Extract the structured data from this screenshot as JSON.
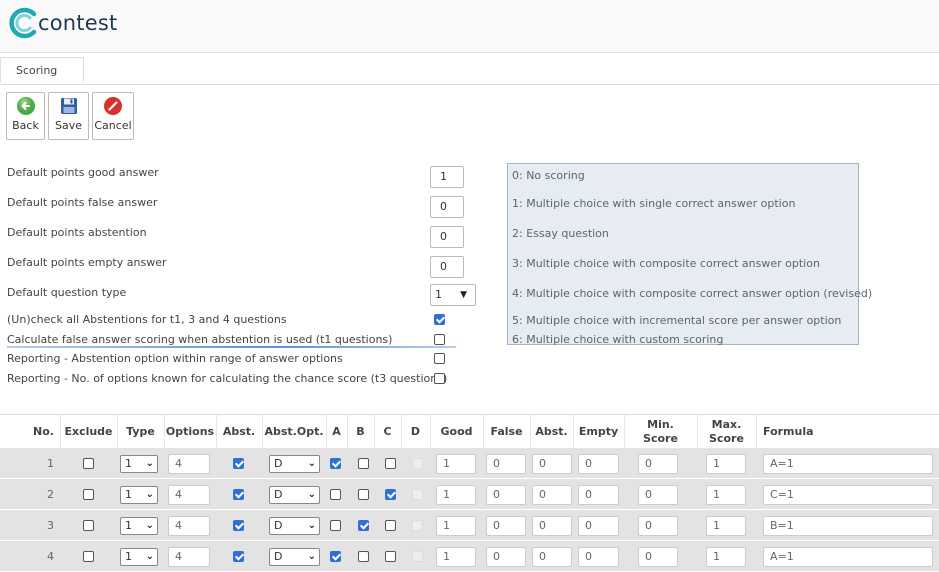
{
  "app": {
    "logo_text": "contest"
  },
  "tabs": [
    {
      "label": "Scoring"
    }
  ],
  "toolbar": {
    "back_label": "Back",
    "save_label": "Save",
    "cancel_label": "Cancel"
  },
  "settings": {
    "good_label": "Default points good answer",
    "good_value": "1",
    "false_label": "Default points false answer",
    "false_value": "0",
    "abst_label": "Default points abstention",
    "abst_value": "0",
    "empty_label": "Default points empty answer",
    "empty_value": "0",
    "qtype_label": "Default question type",
    "qtype_value": "1",
    "uncheck_label": "(Un)check all Abstentions for t1, 3 and 4 questions",
    "calc_label": "Calculate false answer scoring when abstention is used (t1 questions)",
    "report1_label": "Reporting - Abstention option within range of answer options",
    "report2_label": "Reporting - No. of options known for calculating the chance score (t3 questions)"
  },
  "question_types": [
    "0: No scoring",
    "1: Multiple choice with single correct answer option",
    "2: Essay question",
    "3: Multiple choice with composite correct answer option",
    "4: Multiple choice with composite correct answer option (revised)",
    "5: Multiple choice with incremental score per answer option",
    "6: Multiple choice with custom scoring"
  ],
  "grid": {
    "headers": {
      "no": "No.",
      "exclude": "Exclude",
      "type": "Type",
      "options": "Options",
      "abst": "Abst.",
      "abstopt": "Abst.Opt.",
      "a": "A",
      "b": "B",
      "c": "C",
      "d": "D",
      "good": "Good",
      "false": "False",
      "abst2": "Abst.",
      "empty": "Empty",
      "min1": "Min.",
      "min2": "Score",
      "max1": "Max.",
      "max2": "Score",
      "formula": "Formula"
    },
    "rows": [
      {
        "no": "1",
        "type": "1",
        "options": "4",
        "abstopt": "D",
        "good": "1",
        "false": "0",
        "abst": "0",
        "empty": "0",
        "min": "0",
        "max": "1",
        "formula": "A=1"
      },
      {
        "no": "2",
        "type": "1",
        "options": "4",
        "abstopt": "D",
        "good": "1",
        "false": "0",
        "abst": "0",
        "empty": "0",
        "min": "0",
        "max": "1",
        "formula": "C=1"
      },
      {
        "no": "3",
        "type": "1",
        "options": "4",
        "abstopt": "D",
        "good": "1",
        "false": "0",
        "abst": "0",
        "empty": "0",
        "min": "0",
        "max": "1",
        "formula": "B=1"
      },
      {
        "no": "4",
        "type": "1",
        "options": "4",
        "abstopt": "D",
        "good": "1",
        "false": "0",
        "abst": "0",
        "empty": "0",
        "min": "0",
        "max": "1",
        "formula": "A=1"
      }
    ]
  }
}
